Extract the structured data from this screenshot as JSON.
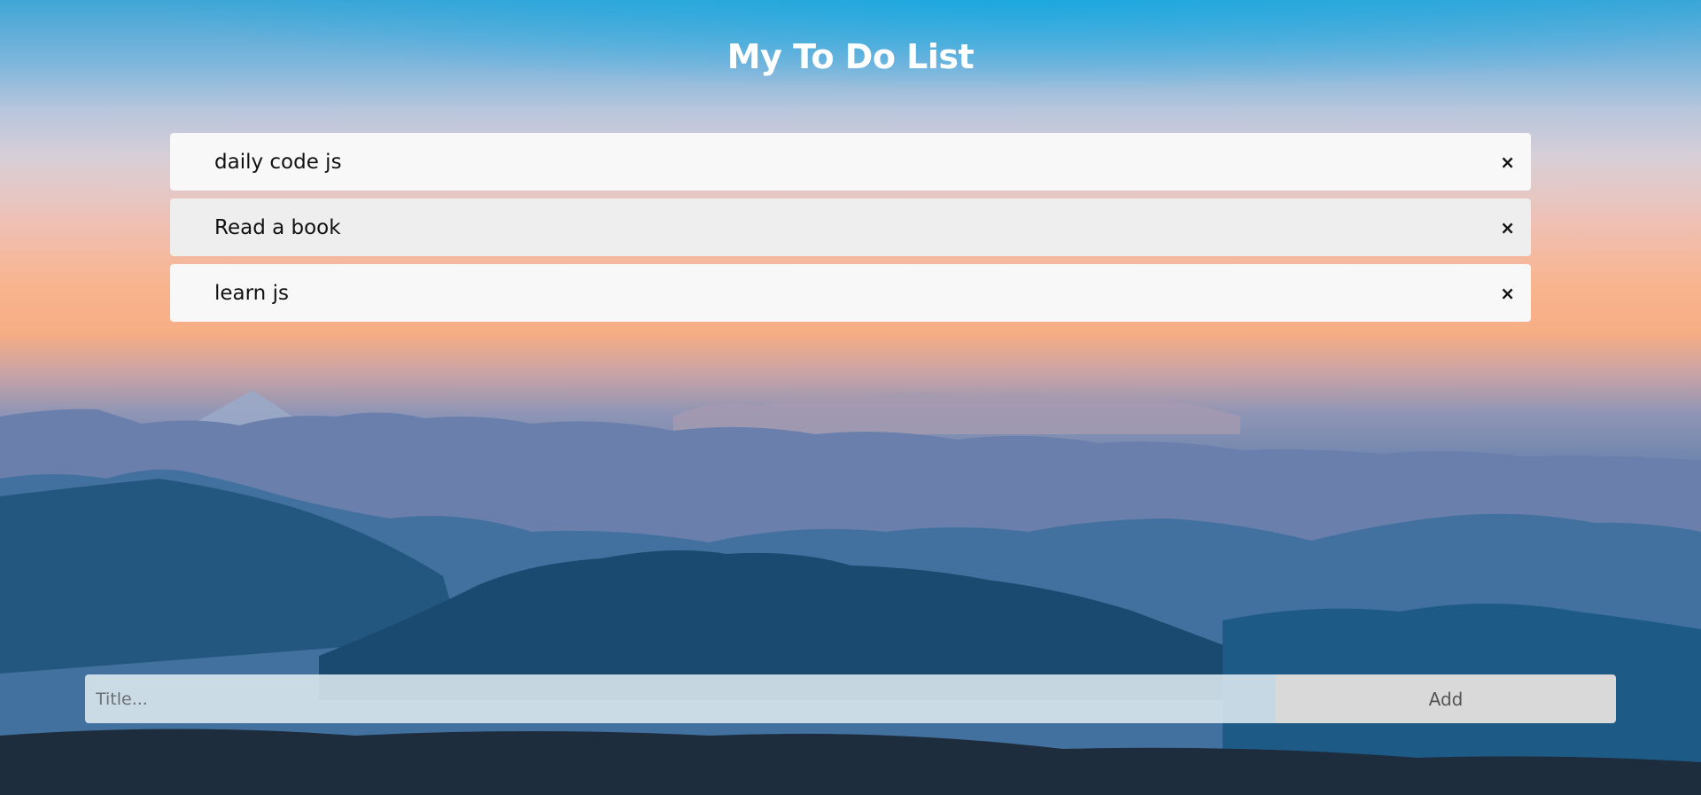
{
  "header": {
    "title": "My To Do List"
  },
  "todos": [
    {
      "label": "daily code js",
      "close_glyph": "×"
    },
    {
      "label": "Read a book",
      "close_glyph": "×"
    },
    {
      "label": "learn js",
      "close_glyph": "×"
    }
  ],
  "form": {
    "input_value": "",
    "input_placeholder": "Title...",
    "add_label": "Add"
  },
  "colors": {
    "item_bg": "#f8f8f8",
    "item_bg_alt": "#eeeeee",
    "button_bg": "#d9d9d9",
    "title_color": "#ffffff"
  },
  "icons": {
    "close": "close-icon"
  }
}
